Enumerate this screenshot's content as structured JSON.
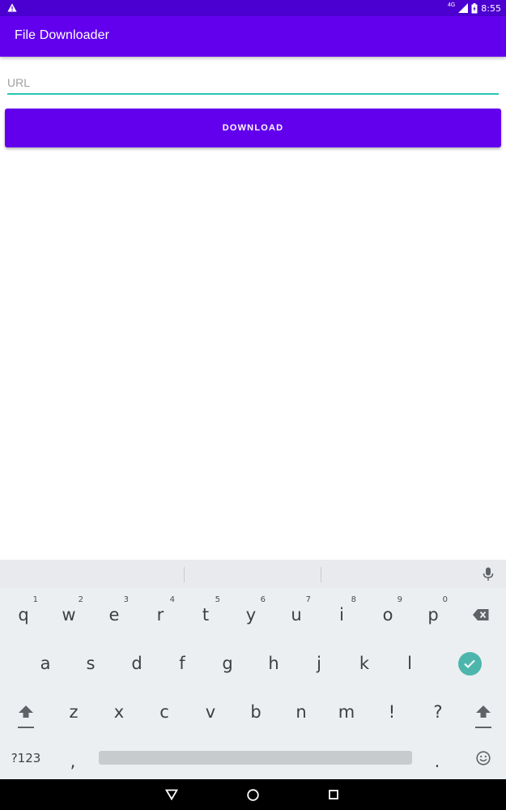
{
  "status_bar": {
    "network": "4G",
    "time": "8:55"
  },
  "app_bar": {
    "title": "File Downloader"
  },
  "form": {
    "url_placeholder": "URL",
    "url_value": "",
    "download_label": "DOWNLOAD"
  },
  "keyboard": {
    "row1": [
      {
        "key": "q",
        "hint": "1"
      },
      {
        "key": "w",
        "hint": "2"
      },
      {
        "key": "e",
        "hint": "3"
      },
      {
        "key": "r",
        "hint": "4"
      },
      {
        "key": "t",
        "hint": "5"
      },
      {
        "key": "y",
        "hint": "6"
      },
      {
        "key": "u",
        "hint": "7"
      },
      {
        "key": "i",
        "hint": "8"
      },
      {
        "key": "o",
        "hint": "9"
      },
      {
        "key": "p",
        "hint": "0"
      }
    ],
    "row2": [
      "a",
      "s",
      "d",
      "f",
      "g",
      "h",
      "j",
      "k",
      "l"
    ],
    "row3": [
      "z",
      "x",
      "c",
      "v",
      "b",
      "n",
      "m",
      "!",
      "?"
    ],
    "symbols_label": "?123",
    "comma": ",",
    "period": "."
  },
  "colors": {
    "primary": "#6200ee",
    "primary_dark": "#4b00d1",
    "accent": "#26c6b6",
    "enter": "#4db6ac"
  }
}
